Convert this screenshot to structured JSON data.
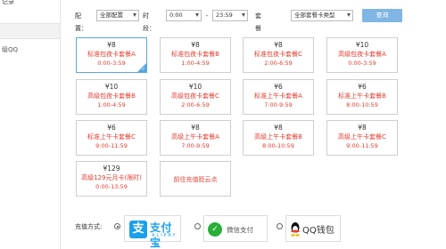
{
  "sidebar": {
    "items": [
      {
        "label": "记录"
      },
      {
        "label": ""
      },
      {
        "label": "级QQ"
      }
    ]
  },
  "filter": {
    "config_label": "配置：",
    "config_value": "全部配置",
    "period_label": "时段：",
    "start_time": "0:00",
    "range_sep": "-",
    "end_time": "23:59",
    "card_type_label": "套餐卡类型",
    "card_type_value": "全部套餐卡类型",
    "query_button": "查询"
  },
  "packages": [
    {
      "price": "¥8",
      "name": "标准包夜卡套餐A",
      "time": "0:00-3:59",
      "selected": true
    },
    {
      "price": "¥8",
      "name": "标准包夜卡套餐B",
      "time": "1:00-4:59"
    },
    {
      "price": "¥8",
      "name": "标准包夜卡套餐C",
      "time": "2:00-6:59"
    },
    {
      "price": "¥10",
      "name": "高级包夜卡套餐A",
      "time": "0:00-3:59"
    },
    {
      "price": "¥10",
      "name": "高级包夜卡套餐B",
      "time": "1:00-4:59"
    },
    {
      "price": "¥10",
      "name": "高级包夜卡套餐C",
      "time": "2:00-6:59"
    },
    {
      "price": "¥6",
      "name": "标准上午卡套餐A",
      "time": "7:00-9:59"
    },
    {
      "price": "¥6",
      "name": "标准上午卡套餐B",
      "time": "8:00-10:59"
    },
    {
      "price": "¥6",
      "name": "标准上午卡套餐C",
      "time": "9:00-11:59"
    },
    {
      "price": "¥8",
      "name": "高级上午卡套餐A",
      "time": "7:00-9:59"
    },
    {
      "price": "¥8",
      "name": "高级上午卡套餐B",
      "time": "8:00-10:59"
    },
    {
      "price": "¥8",
      "name": "高级上午卡套餐C",
      "time": "9:00-11:59"
    },
    {
      "price": "¥129",
      "name": "高级129元月卡(限时)",
      "time": "0:00-13:59"
    }
  ],
  "upgrade_link": "前往充值贬云点",
  "payment": {
    "label": "充值方式:",
    "alipay_cn": "支付宝",
    "alipay_en": "ALIPAY",
    "wechat": "微信支付",
    "qq": "QQ钱包",
    "selected": "alipay"
  },
  "colors": {
    "accent": "#5ba6e0",
    "price_red": "#e23b2e",
    "query_btn": "#7fb6e3",
    "alipay_blue": "#1aa0e8",
    "wechat_green": "#2aae37"
  }
}
